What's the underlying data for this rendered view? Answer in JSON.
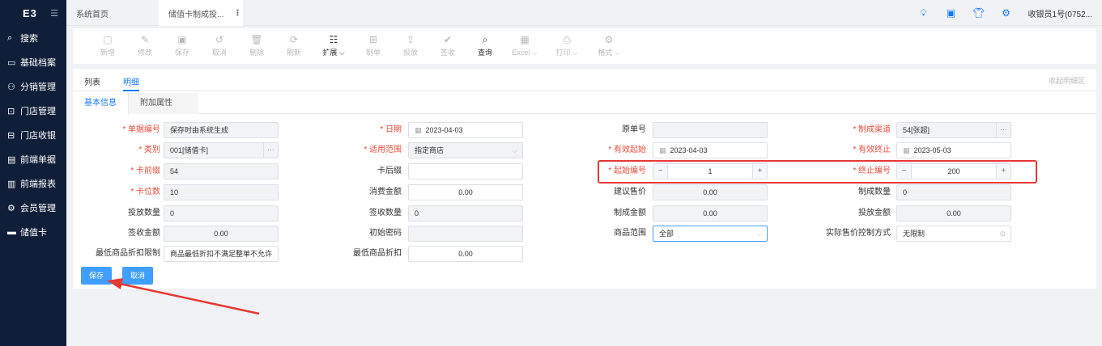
{
  "sidebar": {
    "logo": "E3",
    "toggle_icon": "menu-toggle-icon",
    "items": [
      {
        "icon": "search-icon",
        "label": "搜索"
      },
      {
        "icon": "archive-icon",
        "label": "基础档案"
      },
      {
        "icon": "distribution-icon",
        "label": "分销管理"
      },
      {
        "icon": "store-icon",
        "label": "门店管理"
      },
      {
        "icon": "cashier-icon",
        "label": "门店收银"
      },
      {
        "icon": "document-icon",
        "label": "前端单据"
      },
      {
        "icon": "report-icon",
        "label": "前端报表"
      },
      {
        "icon": "member-icon",
        "label": "会员管理"
      },
      {
        "icon": "card-icon",
        "label": "储值卡"
      }
    ]
  },
  "tabs": {
    "home": "系统首页",
    "active": "储值卡制成投...",
    "more": "⋮"
  },
  "header": {
    "icons": [
      "bulb-icon",
      "monitor-icon",
      "shirt-icon",
      "gear-icon"
    ],
    "user": "收银员1号(0752..."
  },
  "toolbar": {
    "items": [
      {
        "icon": "new-icon",
        "label": "新增",
        "enabled": false
      },
      {
        "icon": "edit-icon",
        "label": "修改",
        "enabled": false
      },
      {
        "icon": "save-icon",
        "label": "保存",
        "enabled": false
      },
      {
        "icon": "undo-icon",
        "label": "取消",
        "enabled": false
      },
      {
        "icon": "delete-icon",
        "label": "删除",
        "enabled": false
      },
      {
        "icon": "refresh-icon",
        "label": "刷新",
        "enabled": false
      },
      {
        "icon": "extend-icon",
        "label": "扩展 ⌵",
        "enabled": true
      },
      {
        "icon": "make-card-icon",
        "label": "制单",
        "enabled": false
      },
      {
        "icon": "release-icon",
        "label": "投放",
        "enabled": false
      },
      {
        "icon": "sign-icon",
        "label": "签收",
        "enabled": false
      },
      {
        "icon": "query-icon",
        "label": "查询",
        "enabled": true
      },
      {
        "icon": "excel-icon",
        "label": "Excel ⌵",
        "enabled": false
      },
      {
        "icon": "print-icon",
        "label": "打印 ⌵",
        "enabled": false
      },
      {
        "icon": "format-icon",
        "label": "格式 ⌵",
        "enabled": false
      }
    ]
  },
  "view_tabs": {
    "list": "列表",
    "detail": "明细",
    "collapse": "收起明细区"
  },
  "sub_tabs": {
    "basic": "基本信息",
    "extra": "附加属性"
  },
  "form": {
    "doc_no_label": "单据编号",
    "doc_no": "保存时由系统生成",
    "date_label": "日期",
    "date": "2023-04-03",
    "orig_no_label": "原单号",
    "orig_no": "",
    "channel_label": "制成渠道",
    "channel": "54[张超]",
    "category_label": "类别",
    "category": "001[储值卡]",
    "scope_label": "适用范围",
    "scope": "指定商店",
    "valid_from_label": "有效起始",
    "valid_from": "2023-04-03",
    "valid_to_label": "有效终止",
    "valid_to": "2023-05-03",
    "prefix_label": "卡前缀",
    "prefix": "54",
    "suffix_label": "卡后缀",
    "suffix": "",
    "start_no_label": "起始编号",
    "start_no": "1",
    "end_no_label": "终止编号",
    "end_no": "200",
    "digits_label": "卡位数",
    "digits": "10",
    "amount_label": "消费金额",
    "amount": "0.00",
    "suggest_price_label": "建议售价",
    "suggest_price": "0.00",
    "made_qty_label": "制成数量",
    "made_qty": "0",
    "release_qty_label": "投放数量",
    "release_qty": "0",
    "sign_qty_label": "签收数量",
    "sign_qty": "0",
    "made_amt_label": "制成金额",
    "made_amt": "0.00",
    "release_amt_label": "投放金额",
    "release_amt": "0.00",
    "sign_amt_label": "签收金额",
    "sign_amt": "0.00",
    "init_pwd_label": "初始密码",
    "init_pwd": "",
    "goods_scope_label": "商品范围",
    "goods_scope": "全部",
    "price_ctrl_label": "实际售价控制方式",
    "price_ctrl": "无限制",
    "min_disc_limit_label": "最低商品折扣限制",
    "min_disc_limit": "商品最低折扣不满足整单不允许",
    "min_disc_label": "最低商品折扣",
    "min_disc": "0.00"
  },
  "actions": {
    "save": "保存",
    "cancel": "取消"
  },
  "colors": {
    "accent": "#409eff",
    "required": "#e74c3c",
    "highlight": "#e53935",
    "sidebar": "#0f1f3a"
  }
}
